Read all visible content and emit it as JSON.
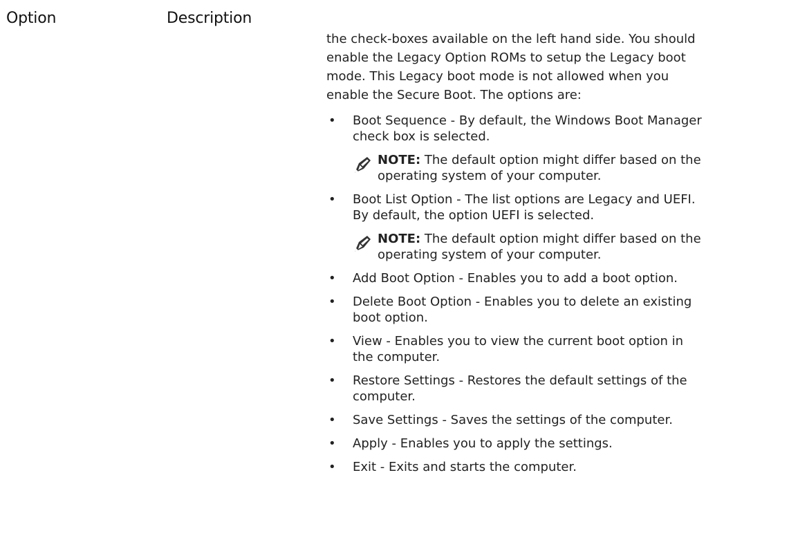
{
  "header": {
    "option_label": "Option",
    "description_label": "Description"
  },
  "intro": {
    "lines": [
      "the check-boxes available on the left hand side. You should",
      "enable the Legacy Option ROMs to setup the Legacy boot",
      "mode. This Legacy boot mode is not allowed when you",
      "enable the Secure Boot. The options are:"
    ]
  },
  "note": {
    "icon": "pencil-note-icon",
    "label": "NOTE:",
    "text_line1": " The default option might differ based on the",
    "text_line2": "operating system of your computer."
  },
  "items": [
    {
      "lines": [
        "Boot Sequence - By default, the Windows Boot Manager",
        "check box is selected."
      ],
      "has_note": true
    },
    {
      "lines": [
        "Boot List Option - The list options are Legacy and UEFI.",
        "By default, the option UEFI is selected."
      ],
      "has_note": true
    },
    {
      "lines": [
        "Add Boot Option - Enables you to add a boot option."
      ],
      "has_note": false
    },
    {
      "lines": [
        "Delete Boot Option - Enables you to delete an existing",
        "boot option."
      ],
      "has_note": false
    },
    {
      "lines": [
        "View - Enables you to view the current boot option in",
        "the computer."
      ],
      "has_note": false
    },
    {
      "lines": [
        "Restore Settings - Restores the default settings of the",
        "computer."
      ],
      "has_note": false
    },
    {
      "lines": [
        "Save Settings - Saves the settings of the computer."
      ],
      "has_note": false
    },
    {
      "lines": [
        "Apply - Enables you to apply the settings."
      ],
      "has_note": false
    },
    {
      "lines": [
        "Exit - Exits and starts the computer."
      ],
      "has_note": false
    }
  ],
  "bullet_glyph": "•"
}
